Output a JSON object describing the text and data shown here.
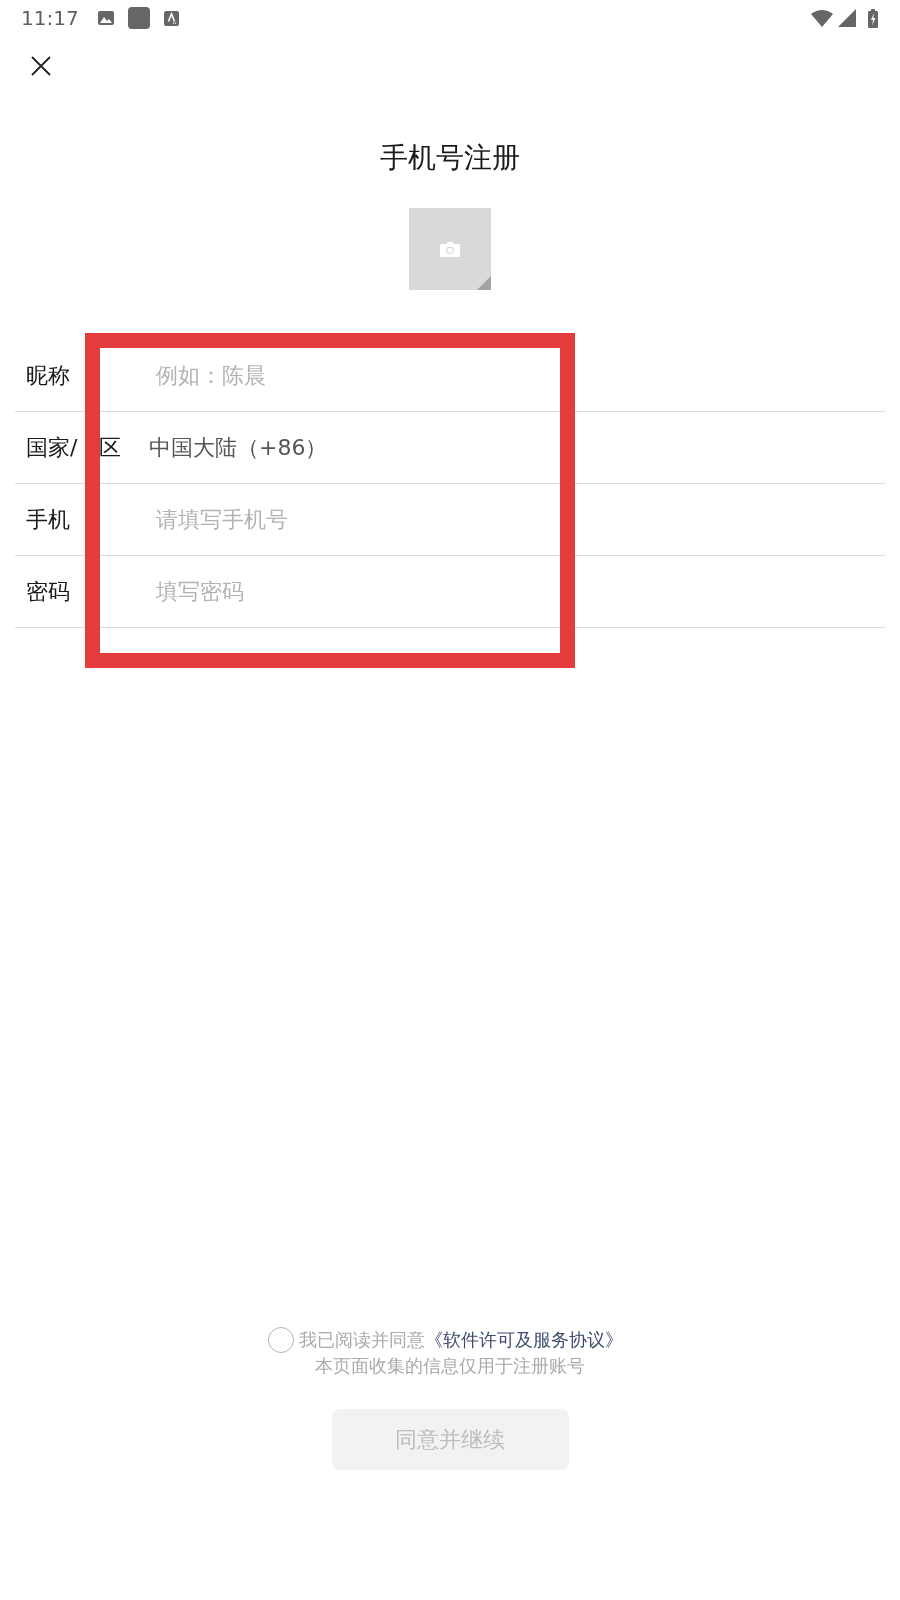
{
  "status_bar": {
    "time": "11:17"
  },
  "header": {
    "title": "手机号注册"
  },
  "form": {
    "rows": [
      {
        "kind": "field",
        "label": "昵称",
        "placeholder": "例如：陈晨"
      },
      {
        "kind": "picker",
        "label": "国家/",
        "label_tail": "区",
        "value": "中国大陆（+86）"
      },
      {
        "kind": "field",
        "label": "手机",
        "placeholder": "请填写手机号"
      },
      {
        "kind": "password",
        "label": "密码",
        "placeholder": "填写密码"
      }
    ]
  },
  "annotation": {
    "kind": "rectangle"
  },
  "agreement": {
    "checked": false,
    "text": "我已阅读并同意",
    "link": "《软件许可及服务协议》",
    "note": "本页面收集的信息仅用于注册账号"
  },
  "submit_button": {
    "label": "同意并继续",
    "disabled": true
  }
}
